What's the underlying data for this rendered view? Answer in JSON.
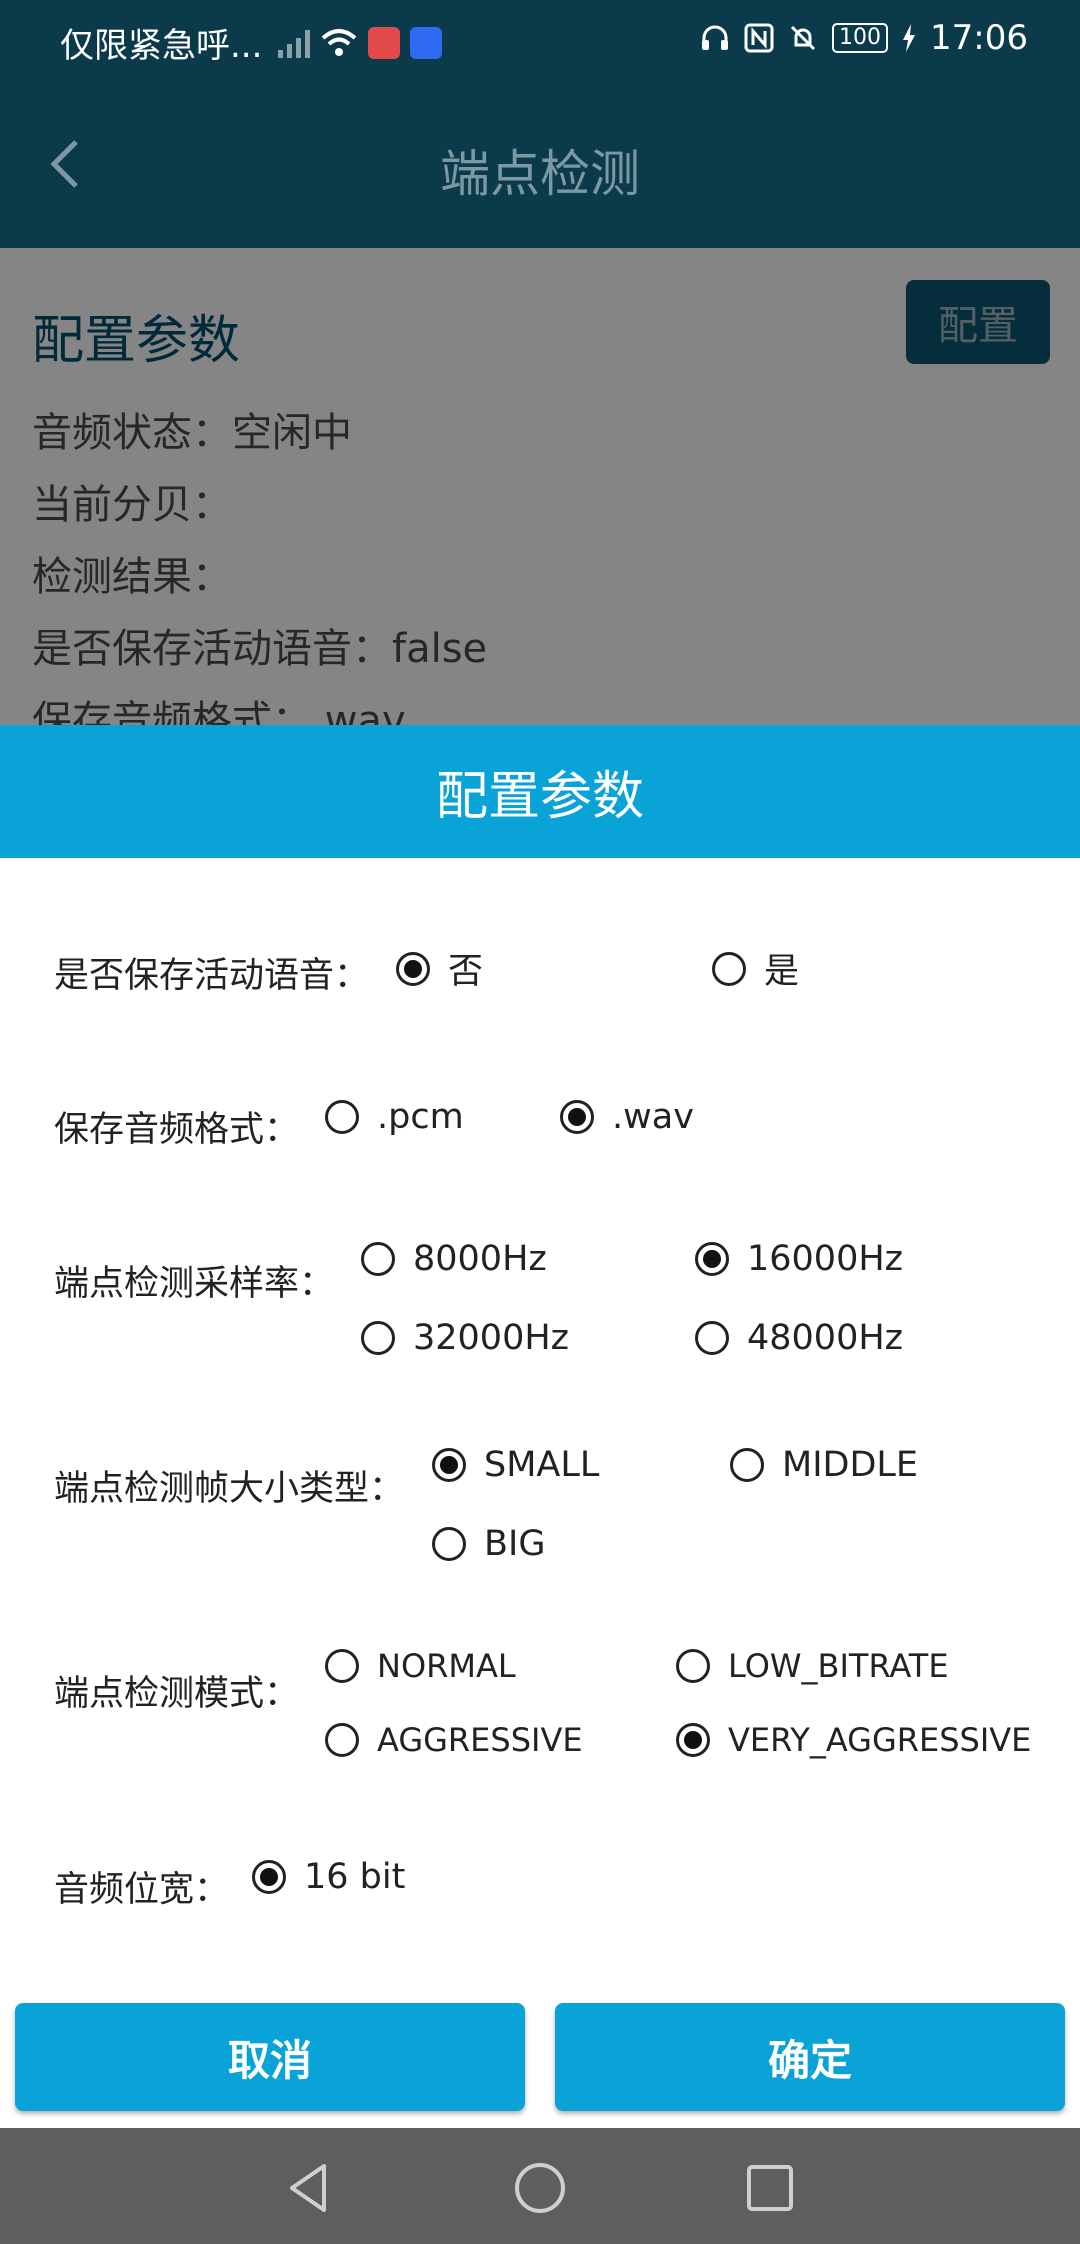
{
  "status_bar": {
    "carrier": "仅限紧急呼...",
    "battery": "100",
    "time": "17:06",
    "icons": [
      "signal-icon",
      "wifi-icon",
      "book-app-icon",
      "bulb-app-icon",
      "headset-icon",
      "nfc-icon",
      "mute-icon",
      "battery-icon",
      "charging-icon"
    ]
  },
  "app_bar": {
    "title": "端点检测"
  },
  "page": {
    "section_title": "配置参数",
    "config_button": "配置",
    "info_lines": [
      "音频状态：空闲中",
      "当前分贝：",
      "检测结果：",
      "是否保存活动语音：false",
      "保存音频格式：.wav"
    ]
  },
  "dialog": {
    "title": "配置参数",
    "save_voice": {
      "label": "是否保存活动语音：",
      "options": [
        "否",
        "是"
      ],
      "selected": "否"
    },
    "audio_format": {
      "label": "保存音频格式：",
      "options": [
        ".pcm",
        ".wav"
      ],
      "selected": ".wav"
    },
    "sample_rate": {
      "label": "端点检测采样率：",
      "options": [
        "8000Hz",
        "16000Hz",
        "32000Hz",
        "48000Hz"
      ],
      "selected": "16000Hz"
    },
    "frame_size": {
      "label": "端点检测帧大小类型：",
      "options": [
        "SMALL",
        "MIDDLE",
        "BIG"
      ],
      "selected": "SMALL"
    },
    "mode": {
      "label": "端点检测模式：",
      "options": [
        "NORMAL",
        "LOW_BITRATE",
        "AGGRESSIVE",
        "VERY_AGGRESSIVE"
      ],
      "selected": "VERY_AGGRESSIVE"
    },
    "bit_width": {
      "label": "音频位宽：",
      "options": [
        "16 bit"
      ],
      "selected": "16 bit"
    },
    "cancel_button": "取消",
    "confirm_button": "确定"
  },
  "colors": {
    "toolbar": "#0b3a4b",
    "dialog_accent": "#0aa3d8",
    "title_text": "#00506e",
    "nav_bar": "#5e5e5e"
  }
}
